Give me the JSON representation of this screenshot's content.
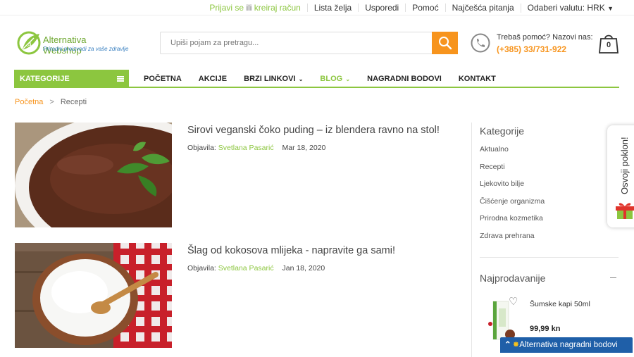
{
  "topbar": {
    "login": "Prijavi se",
    "or": "ili",
    "register": "kreiraj račun",
    "wishlist": "Lista želja",
    "compare": "Usporedi",
    "help": "Pomoć",
    "faq": "Najčešća pitanja",
    "currency_label": "Odaberi valutu:",
    "currency_value": "HRK"
  },
  "header": {
    "logo_title": "Alternativa Webshop",
    "logo_tagline": "Prirodni proizvodi za vaše zdravlje",
    "search_placeholder": "Upiši pojam za pretragu...",
    "help_question": "Trebaš pomoć? Nazovi nas:",
    "help_phone": "(+385) 33/731-922",
    "cart_count": "0"
  },
  "nav": {
    "categories": "KATEGORIJE",
    "items": [
      "POČETNA",
      "AKCIJE",
      "BRZI LINKOVI",
      "BLOG",
      "NAGRADNI BODOVI",
      "KONTAKT"
    ]
  },
  "breadcrumb": {
    "home": "Početna",
    "sep": ">",
    "current": "Recepti"
  },
  "posts": [
    {
      "title": "Sirovi veganski čoko puding – iz blendera ravno na stol!",
      "by": "Objavila:",
      "author": "Svetlana Pasarić",
      "date": "Mar 18, 2020"
    },
    {
      "title": "Šlag od kokosova mlijeka - napravite ga sami!",
      "by": "Objavila:",
      "author": "Svetlana Pasarić",
      "date": "Jan 18, 2020"
    }
  ],
  "sidebar": {
    "categories_title": "Kategorije",
    "categories": [
      "Aktualno",
      "Recepti",
      "Ljekovito bilje",
      "Čišćenje organizma",
      "Prirodna kozmetika",
      "Zdrava prehrana"
    ],
    "bestsellers_title": "Najprodavanije",
    "product_name": "Šumske kapi 50ml",
    "product_price": "99,99 kn"
  },
  "gift_tab": "Osvoji poklon!",
  "badge": "Alternativa nagradni bodovi",
  "colors": {
    "accent_green": "#8cc63f",
    "accent_orange": "#f7941d",
    "badge_blue": "#1f5fa8"
  }
}
